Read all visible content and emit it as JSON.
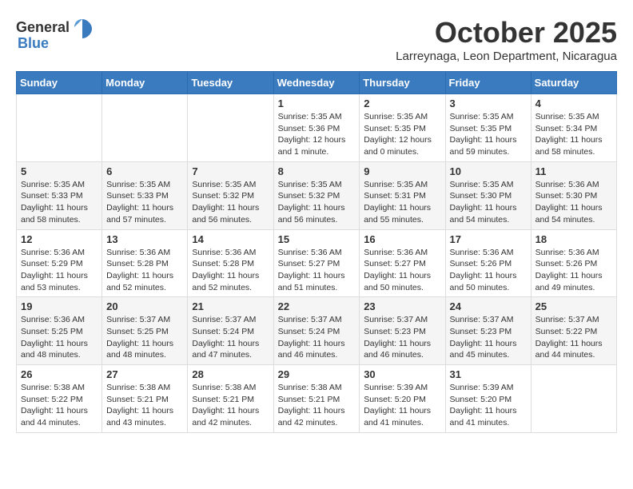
{
  "header": {
    "logo_general": "General",
    "logo_blue": "Blue",
    "month_year": "October 2025",
    "location": "Larreynaga, Leon Department, Nicaragua"
  },
  "weekdays": [
    "Sunday",
    "Monday",
    "Tuesday",
    "Wednesday",
    "Thursday",
    "Friday",
    "Saturday"
  ],
  "weeks": [
    [
      {
        "day": "",
        "info": ""
      },
      {
        "day": "",
        "info": ""
      },
      {
        "day": "",
        "info": ""
      },
      {
        "day": "1",
        "info": "Sunrise: 5:35 AM\nSunset: 5:36 PM\nDaylight: 12 hours\nand 1 minute."
      },
      {
        "day": "2",
        "info": "Sunrise: 5:35 AM\nSunset: 5:35 PM\nDaylight: 12 hours\nand 0 minutes."
      },
      {
        "day": "3",
        "info": "Sunrise: 5:35 AM\nSunset: 5:35 PM\nDaylight: 11 hours\nand 59 minutes."
      },
      {
        "day": "4",
        "info": "Sunrise: 5:35 AM\nSunset: 5:34 PM\nDaylight: 11 hours\nand 58 minutes."
      }
    ],
    [
      {
        "day": "5",
        "info": "Sunrise: 5:35 AM\nSunset: 5:33 PM\nDaylight: 11 hours\nand 58 minutes."
      },
      {
        "day": "6",
        "info": "Sunrise: 5:35 AM\nSunset: 5:33 PM\nDaylight: 11 hours\nand 57 minutes."
      },
      {
        "day": "7",
        "info": "Sunrise: 5:35 AM\nSunset: 5:32 PM\nDaylight: 11 hours\nand 56 minutes."
      },
      {
        "day": "8",
        "info": "Sunrise: 5:35 AM\nSunset: 5:32 PM\nDaylight: 11 hours\nand 56 minutes."
      },
      {
        "day": "9",
        "info": "Sunrise: 5:35 AM\nSunset: 5:31 PM\nDaylight: 11 hours\nand 55 minutes."
      },
      {
        "day": "10",
        "info": "Sunrise: 5:35 AM\nSunset: 5:30 PM\nDaylight: 11 hours\nand 54 minutes."
      },
      {
        "day": "11",
        "info": "Sunrise: 5:36 AM\nSunset: 5:30 PM\nDaylight: 11 hours\nand 54 minutes."
      }
    ],
    [
      {
        "day": "12",
        "info": "Sunrise: 5:36 AM\nSunset: 5:29 PM\nDaylight: 11 hours\nand 53 minutes."
      },
      {
        "day": "13",
        "info": "Sunrise: 5:36 AM\nSunset: 5:28 PM\nDaylight: 11 hours\nand 52 minutes."
      },
      {
        "day": "14",
        "info": "Sunrise: 5:36 AM\nSunset: 5:28 PM\nDaylight: 11 hours\nand 52 minutes."
      },
      {
        "day": "15",
        "info": "Sunrise: 5:36 AM\nSunset: 5:27 PM\nDaylight: 11 hours\nand 51 minutes."
      },
      {
        "day": "16",
        "info": "Sunrise: 5:36 AM\nSunset: 5:27 PM\nDaylight: 11 hours\nand 50 minutes."
      },
      {
        "day": "17",
        "info": "Sunrise: 5:36 AM\nSunset: 5:26 PM\nDaylight: 11 hours\nand 50 minutes."
      },
      {
        "day": "18",
        "info": "Sunrise: 5:36 AM\nSunset: 5:26 PM\nDaylight: 11 hours\nand 49 minutes."
      }
    ],
    [
      {
        "day": "19",
        "info": "Sunrise: 5:36 AM\nSunset: 5:25 PM\nDaylight: 11 hours\nand 48 minutes."
      },
      {
        "day": "20",
        "info": "Sunrise: 5:37 AM\nSunset: 5:25 PM\nDaylight: 11 hours\nand 48 minutes."
      },
      {
        "day": "21",
        "info": "Sunrise: 5:37 AM\nSunset: 5:24 PM\nDaylight: 11 hours\nand 47 minutes."
      },
      {
        "day": "22",
        "info": "Sunrise: 5:37 AM\nSunset: 5:24 PM\nDaylight: 11 hours\nand 46 minutes."
      },
      {
        "day": "23",
        "info": "Sunrise: 5:37 AM\nSunset: 5:23 PM\nDaylight: 11 hours\nand 46 minutes."
      },
      {
        "day": "24",
        "info": "Sunrise: 5:37 AM\nSunset: 5:23 PM\nDaylight: 11 hours\nand 45 minutes."
      },
      {
        "day": "25",
        "info": "Sunrise: 5:37 AM\nSunset: 5:22 PM\nDaylight: 11 hours\nand 44 minutes."
      }
    ],
    [
      {
        "day": "26",
        "info": "Sunrise: 5:38 AM\nSunset: 5:22 PM\nDaylight: 11 hours\nand 44 minutes."
      },
      {
        "day": "27",
        "info": "Sunrise: 5:38 AM\nSunset: 5:21 PM\nDaylight: 11 hours\nand 43 minutes."
      },
      {
        "day": "28",
        "info": "Sunrise: 5:38 AM\nSunset: 5:21 PM\nDaylight: 11 hours\nand 42 minutes."
      },
      {
        "day": "29",
        "info": "Sunrise: 5:38 AM\nSunset: 5:21 PM\nDaylight: 11 hours\nand 42 minutes."
      },
      {
        "day": "30",
        "info": "Sunrise: 5:39 AM\nSunset: 5:20 PM\nDaylight: 11 hours\nand 41 minutes."
      },
      {
        "day": "31",
        "info": "Sunrise: 5:39 AM\nSunset: 5:20 PM\nDaylight: 11 hours\nand 41 minutes."
      },
      {
        "day": "",
        "info": ""
      }
    ]
  ]
}
